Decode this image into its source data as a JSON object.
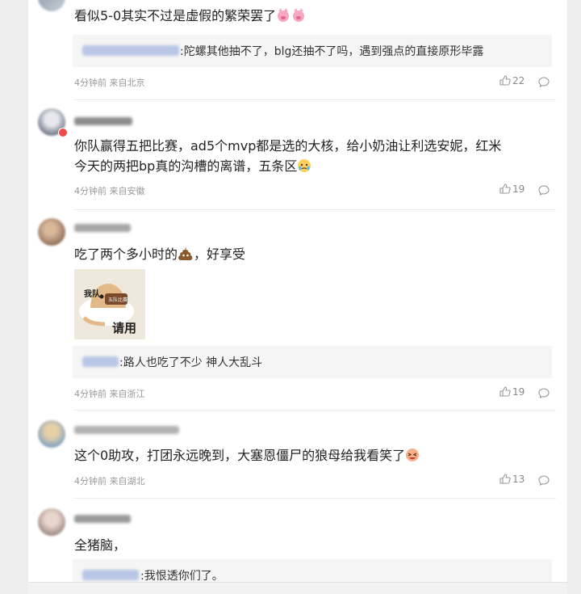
{
  "colors": {
    "background": "#ededed",
    "panel": "#ffffff",
    "meta_text": "#999999",
    "reply_bg": "#f5f5f5"
  },
  "comments": [
    {
      "text": "看似5-0其实不过是虚假的繁荣罢了",
      "emoji": "pig-face-emoji x2",
      "reply": {
        "text": ":陀螺其他抽不了，blg还抽不了吗，遇到强点的直接原形毕露"
      },
      "time": "4分钟前",
      "location": "来自北京",
      "likes": "22"
    },
    {
      "text_line1": "你队赢得五把比赛，ad5个mvp都是选的大核，给小奶油让利选安妮，红米",
      "text_line2": "今天的两把bp真的沟槽的离谱，五条区",
      "emoji": "crying-face-emoji",
      "time": "4分钟前",
      "location": "来自安徽",
      "likes": "19"
    },
    {
      "text_before": "吃了两个多小时的",
      "text_after": "，好享受",
      "emoji": "poop-emoji",
      "sticker": {
        "top_label": "我队",
        "plate_label": "五队比赛",
        "caption": "请用"
      },
      "reply": {
        "text": ":路人也吃了不少 神人大乱斗"
      },
      "time": "4分钟前",
      "location": "来自浙江",
      "likes": "19"
    },
    {
      "text": "这个0助攻，打团永远晚到，大塞恩僵尸的狼母给我看笑了",
      "emoji": "laughing-face-emoji",
      "time": "4分钟前",
      "location": "来自湖北",
      "likes": "13"
    },
    {
      "text": "全猪脑，",
      "reply": {
        "text": ":我恨透你们了。"
      }
    }
  ]
}
